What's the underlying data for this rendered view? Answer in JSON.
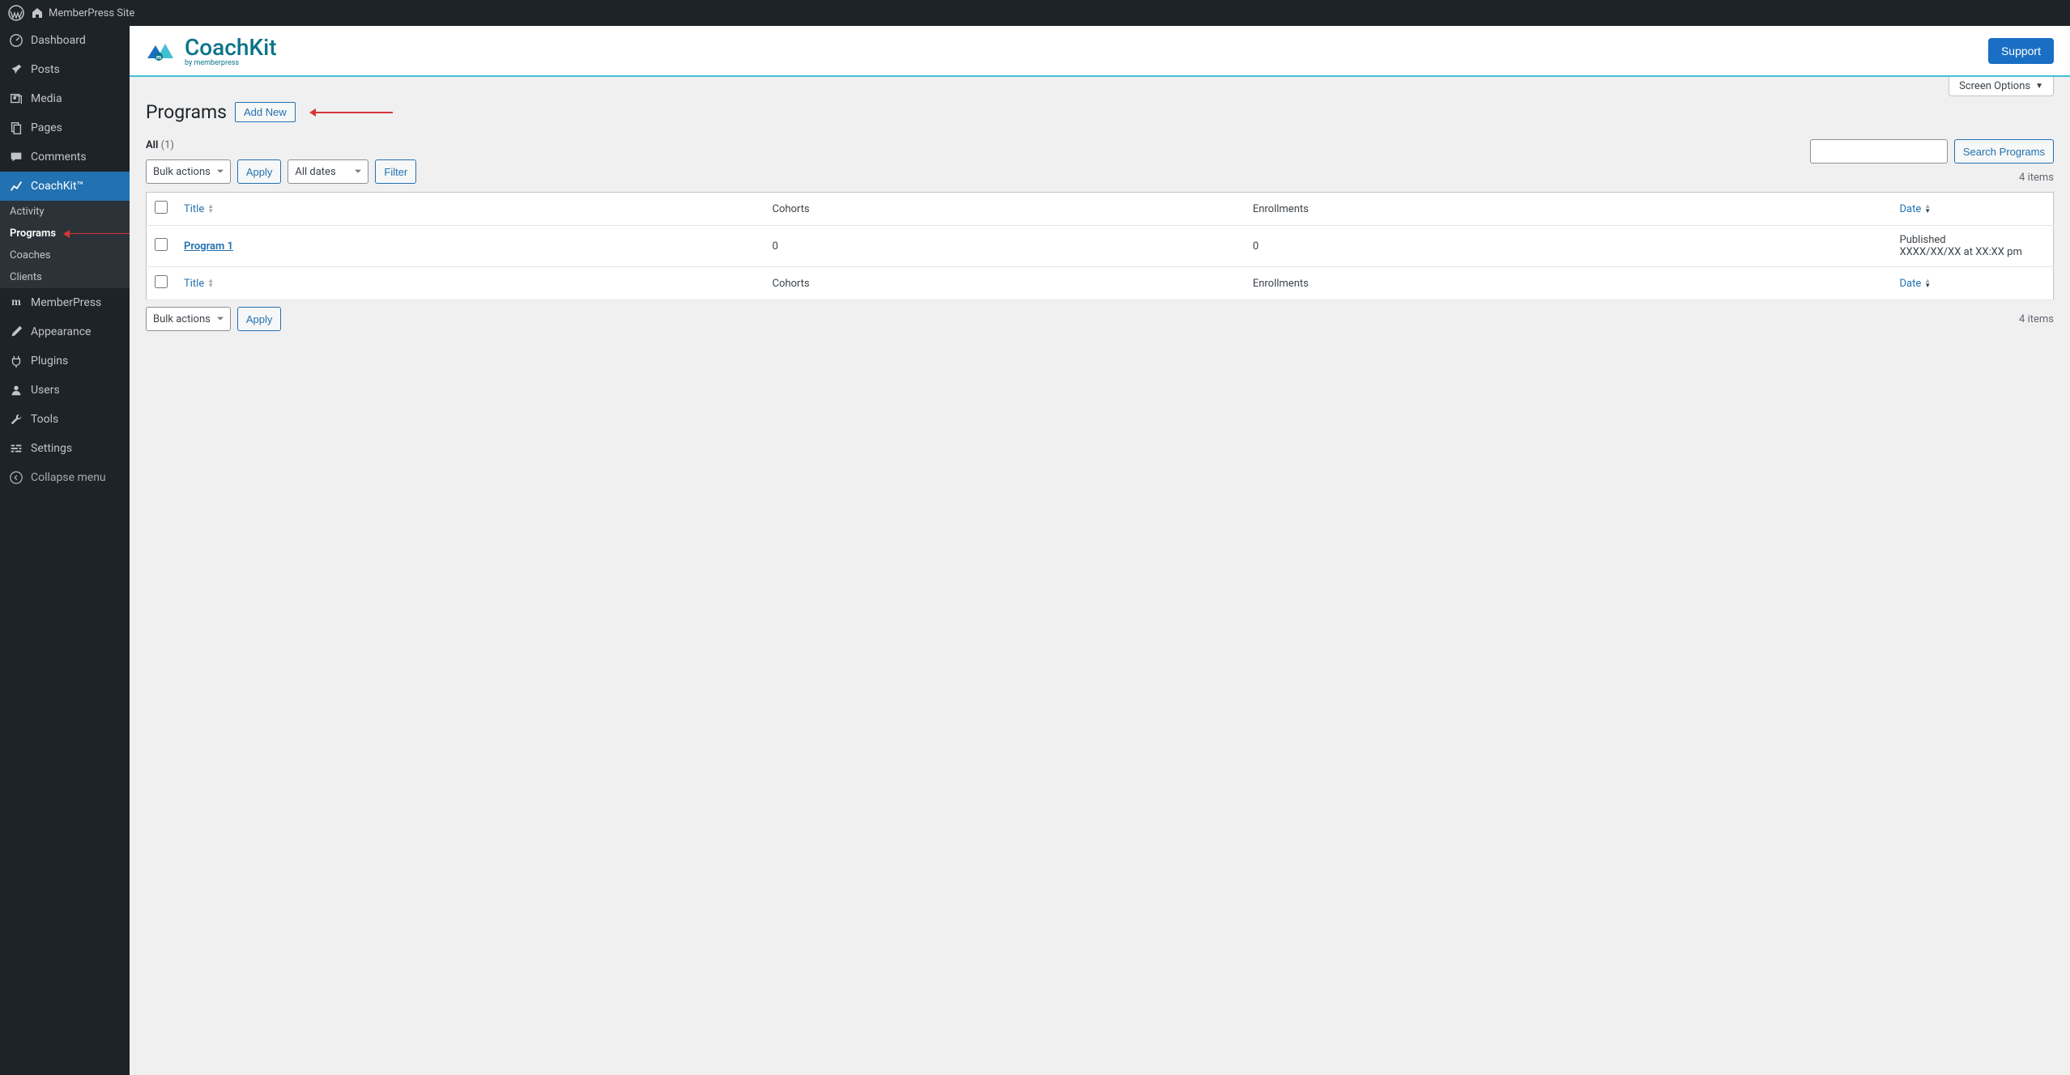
{
  "topbar": {
    "site_name": "MemberPress Site"
  },
  "sidebar": {
    "items": [
      {
        "label": "Dashboard",
        "icon": "dashboard"
      },
      {
        "label": "Posts",
        "icon": "pin"
      },
      {
        "label": "Media",
        "icon": "media"
      },
      {
        "label": "Pages",
        "icon": "pages"
      },
      {
        "label": "Comments",
        "icon": "comments"
      },
      {
        "label": "CoachKit™",
        "icon": "chart"
      },
      {
        "label": "MemberPress",
        "icon": "m"
      },
      {
        "label": "Appearance",
        "icon": "brush"
      },
      {
        "label": "Plugins",
        "icon": "plug"
      },
      {
        "label": "Users",
        "icon": "user"
      },
      {
        "label": "Tools",
        "icon": "wrench"
      },
      {
        "label": "Settings",
        "icon": "settings"
      },
      {
        "label": "Collapse menu",
        "icon": "collapse"
      }
    ],
    "submenu": [
      {
        "label": "Activity"
      },
      {
        "label": "Programs"
      },
      {
        "label": "Coaches"
      },
      {
        "label": "Clients"
      }
    ]
  },
  "brand": {
    "name": "CoachKit",
    "byline": "by memberpress",
    "support": "Support"
  },
  "screen_options": "Screen Options",
  "page": {
    "title": "Programs",
    "add_new": "Add New",
    "status_all": "All",
    "status_count": "(1)",
    "bulk_actions": "Bulk actions",
    "apply": "Apply",
    "all_dates": "All dates",
    "filter": "Filter",
    "search_btn": "Search Programs",
    "items_count": "4 items"
  },
  "table": {
    "cols": {
      "title": "Title",
      "cohorts": "Cohorts",
      "enrollments": "Enrollments",
      "date": "Date"
    },
    "rows": [
      {
        "title": "Program 1",
        "cohorts": "0",
        "enrollments": "0",
        "status": "Published",
        "date": "XXXX/XX/XX at XX:XX pm"
      }
    ]
  }
}
